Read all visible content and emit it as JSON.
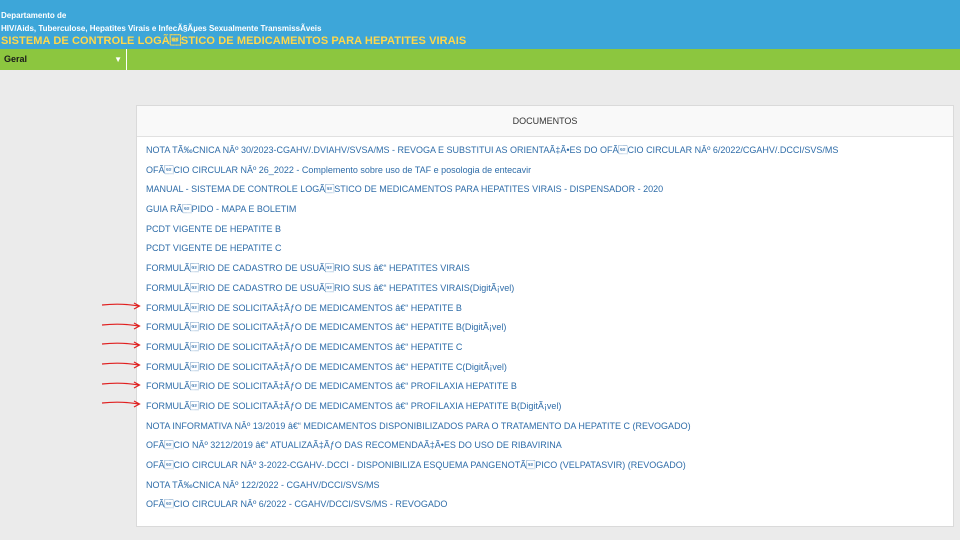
{
  "header": {
    "dept_line1": "Departamento de",
    "dept_line2": "HIV/Aids, Tuberculose, Hepatites Virais e InfecÃ§Ãµes Sexualmente TransmissÃveis",
    "system_title": "SISTEMA DE CONTROLE LOGÃ\u001dSTICO DE MEDICAMENTOS PARA HEPATITES VIRAIS"
  },
  "menu": {
    "selected": "Geral",
    "caret_icon": "caret-down-icon"
  },
  "panel": {
    "title": "DOCUMENTOS",
    "documents": [
      "NOTA TÃ‰CNICA NÂº 30/2023-CGAHV/.DVIAHV/SVSA/MS - REVOGA E SUBSTITUI AS ORIENTAÃ‡Ã•ES DO OFÃ\u001dCIO CIRCULAR NÂº 6/2022/CGAHV/.DCCI/SVS/MS",
      "OFÃ\u001dCIO CIRCULAR NÂº 26_2022 - Complemento sobre uso de TAF e posologia de entecavir",
      "MANUAL - SISTEMA DE CONTROLE LOGÃ\u001dSTICO DE MEDICAMENTOS PARA HEPATITES VIRAIS - DISPENSADOR - 2020",
      "GUIA RÃ\u001dPIDO - MAPA E BOLETIM",
      "PCDT VIGENTE DE HEPATITE B",
      "PCDT VIGENTE DE HEPATITE C",
      "FORMULÃ\u001dRIO DE CADASTRO DE USUÃ\u001dRIO SUS â€“ HEPATITES VIRAIS",
      "FORMULÃ\u001dRIO DE CADASTRO DE USUÃ\u001dRIO SUS â€“ HEPATITES VIRAIS(DigitÃ¡vel)",
      "FORMULÃ\u001dRIO DE SOLICITAÃ‡ÃƒO DE MEDICAMENTOS â€“ HEPATITE B",
      "FORMULÃ\u001dRIO DE SOLICITAÃ‡ÃƒO DE MEDICAMENTOS â€“ HEPATITE B(DigitÃ¡vel)",
      "FORMULÃ\u001dRIO DE SOLICITAÃ‡ÃƒO DE MEDICAMENTOS â€“ HEPATITE C",
      "FORMULÃ\u001dRIO DE SOLICITAÃ‡ÃƒO DE MEDICAMENTOS â€“ HEPATITE C(DigitÃ¡vel)",
      "FORMULÃ\u001dRIO DE SOLICITAÃ‡ÃƒO DE MEDICAMENTOS â€“ PROFILAXIA HEPATITE B",
      "FORMULÃ\u001dRIO DE SOLICITAÃ‡ÃƒO DE MEDICAMENTOS â€“ PROFILAXIA HEPATITE B(DigitÃ¡vel)",
      "NOTA INFORMATIVA NÂº 13/2019 â€“ MEDICAMENTOS DISPONIBILIZADOS PARA O TRATAMENTO DA HEPATITE C (REVOGADO)",
      "OFÃ\u001dCIO NÂº 3212/2019 â€“ ATUALIZAÃ‡ÃƒO DAS RECOMENDAÃ‡Ã•ES DO USO DE RIBAVIRINA",
      "OFÃ\u001dCIO CIRCULAR NÂº 3-2022-CGAHV-.DCCI - DISPONIBILIZA ESQUEMA PANGENOTÃ\u001dPICO (VELPATASVIR) (REVOGADO)",
      "NOTA TÃ‰CNICA NÂº 122/2022 - CGAHV/DCCI/SVS/MS",
      "OFÃ\u001dCIO CIRCULAR NÂº 6/2022 - CGAHV/DCCI/SVS/MS - REVOGADO"
    ]
  },
  "annotations": {
    "arrow_icon": "red-arrow-icon",
    "arrow_color": "#e02020"
  },
  "colors": {
    "header_bg": "#3da6d9",
    "title_color": "#ffd84a",
    "menubar_bg": "#8cc63f",
    "link_color": "#2e6ca8"
  }
}
